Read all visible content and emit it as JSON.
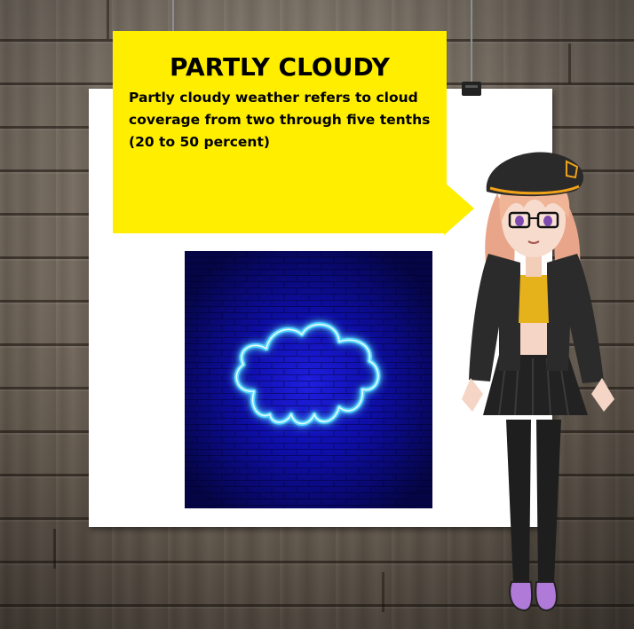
{
  "slide": {
    "title": "PARTLY CLOUDY",
    "description": "Partly cloudy weather refers to cloud coverage from two through five tenths (20 to 50 percent)"
  },
  "illustration": {
    "icon": "neon-cloud-icon",
    "glow_color": "#4fd3ff",
    "background_color": "#0a0a7a"
  },
  "character": {
    "icon": "anime-girl-character"
  },
  "colors": {
    "callout": "#ffee00",
    "poster": "#ffffff",
    "wood": "#766b5f"
  }
}
